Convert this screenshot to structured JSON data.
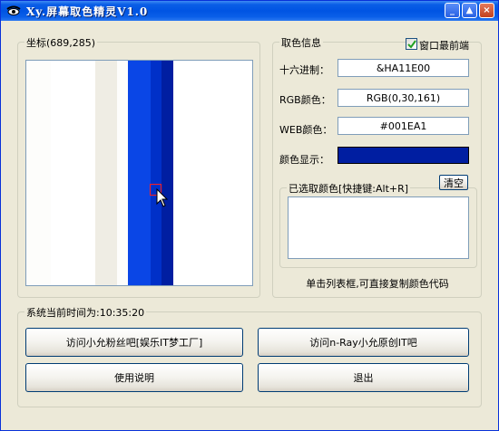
{
  "window": {
    "title": "Xy.屏幕取色精灵V1.0"
  },
  "title_buttons": {
    "minimize": "_",
    "maximize": "▲",
    "close": "×"
  },
  "coord_group": {
    "legend": "坐标(689,285)"
  },
  "preview": {
    "strips": [
      "#fdfdfb",
      "#efede4",
      "#fdfdfb",
      "#0a46e6",
      "#0030c8",
      "#001ea1",
      "#ffffff"
    ]
  },
  "color_info": {
    "legend": "取色信息",
    "topmost_label": "窗口最前端",
    "topmost_checked": true,
    "hex_label": "十六进制：",
    "hex_value": "&HA11E00",
    "rgb_label": "RGB颜色：",
    "rgb_value": "RGB(0,30,161)",
    "web_label": "WEB颜色：",
    "web_value": "#001EA1",
    "display_label": "颜色显示：",
    "display_color": "#001ea1"
  },
  "picked": {
    "legend": "已选取颜色[快捷键:Alt+R]",
    "clear_button": "清空",
    "hint": "单击列表框,可直接复制颜色代码"
  },
  "system": {
    "legend": "系统当前时间为:10:35:20",
    "btn_fans": "访问小允粉丝吧[娱乐IT梦工厂]",
    "btn_original": "访问n-Ray小允原创IT吧",
    "btn_help": "使用说明",
    "btn_exit": "退出"
  }
}
